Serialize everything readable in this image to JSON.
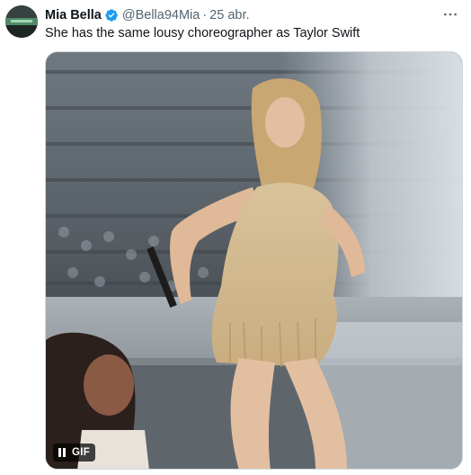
{
  "tweet": {
    "author_name": "Mia Bella",
    "author_handle": "@Bella94Mia",
    "separator": "·",
    "date": "25 abr.",
    "text": "She has the same lousy choreographer as Taylor Swift",
    "more_icon": "more-horizontal-icon",
    "verified_icon": "verified-badge-icon",
    "verified_color": "#1d9bf0"
  },
  "media": {
    "type": "gif",
    "badge_label": "GIF",
    "control_icon": "pause-icon"
  }
}
